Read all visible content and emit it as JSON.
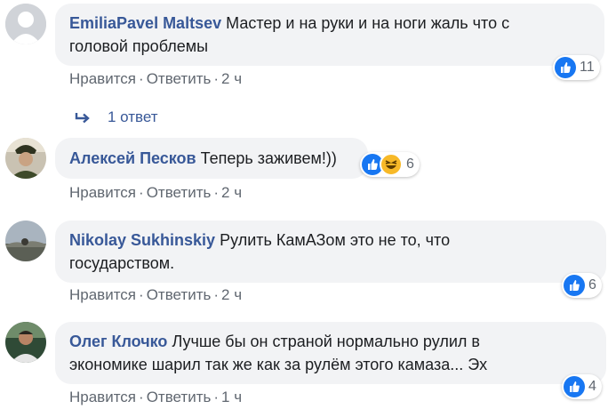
{
  "comments": [
    {
      "author": "EmiliaPavel Maltsev",
      "text_line1": "Мастер и на руки и на ноги жаль что с",
      "text_line2": "головой проблемы",
      "like_label": "Нравится",
      "reply_label": "Ответить",
      "time": "2 ч",
      "reactions": "11"
    },
    {
      "author": "Алексей Песков",
      "text_line1": "Теперь заживем!))",
      "like_label": "Нравится",
      "reply_label": "Ответить",
      "time": "2 ч",
      "reactions": "6"
    },
    {
      "author": "Nikolay Sukhinskiy",
      "text_line1": "Рулить КамАЗом это не то, что",
      "text_line2": "государством.",
      "like_label": "Нравится",
      "reply_label": "Ответить",
      "time": "2 ч",
      "reactions": "6"
    },
    {
      "author": "Олег Клочко",
      "text_line1": "Лучше бы он страной нормально рулил в",
      "text_line2": "экономике шарил так же как за рулём этого камаза... Эх",
      "like_label": "Нравится",
      "reply_label": "Ответить",
      "time": "1 ч",
      "reactions": "4"
    }
  ],
  "replies_toggle": "1 ответ",
  "dot": "·",
  "colors": {
    "author": "#385898",
    "bubble": "#f2f3f5",
    "like": "#1877f2",
    "haha": "#f7b928",
    "meta": "#606770"
  }
}
